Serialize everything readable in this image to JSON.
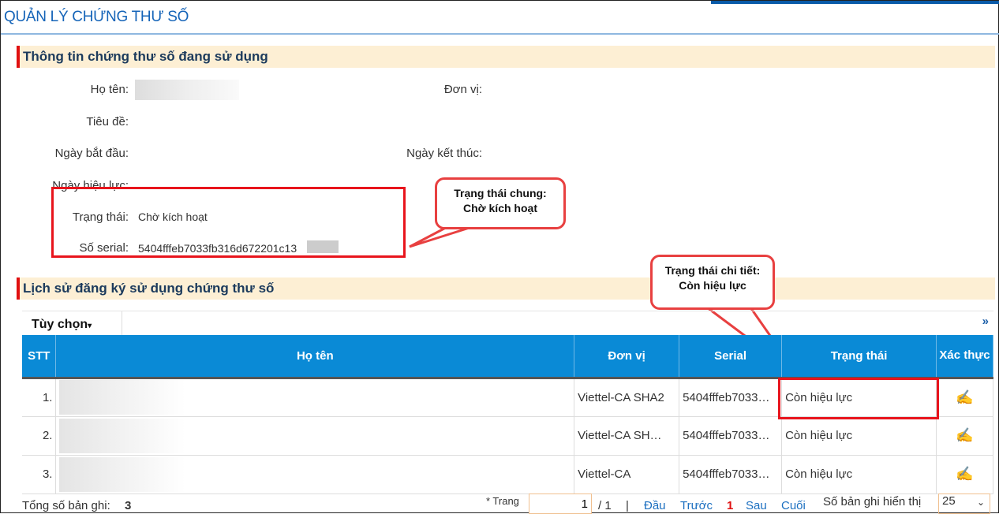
{
  "title": "QUẢN LÝ CHỨNG THƯ SỐ",
  "section1": {
    "title": "Thông tin chứng thư số đang sử dụng",
    "fields": {
      "ho_ten": "Họ tên:",
      "don_vi": "Đơn vị:",
      "tieu_de": "Tiêu đề:",
      "ngay_bat_dau": "Ngày bắt đầu:",
      "ngay_ket_thuc": "Ngày kết thúc:",
      "ngay_hieu_luc": "Ngày hiệu lực:",
      "trang_thai": "Trạng thái:",
      "so_serial": "Số serial:"
    },
    "values": {
      "trang_thai": "Chờ kích hoạt",
      "so_serial": "5404fffeb7033fb316d672201c13"
    }
  },
  "callout1": {
    "line1": "Trạng thái chung:",
    "line2": "Chờ kích hoạt"
  },
  "callout2": {
    "line1": "Trạng thái chi tiết:",
    "line2": "Còn hiệu lực"
  },
  "section2": {
    "title": "Lịch sử đăng ký sử dụng chứng thư số",
    "options": "Tùy chọn",
    "expand": "»"
  },
  "table": {
    "headers": [
      "STT",
      "Họ tên",
      "Đơn vị",
      "Serial",
      "Trạng thái",
      "Xác thực"
    ],
    "rows": [
      {
        "stt": "1.",
        "don_vi": "Viettel-CA SHA2",
        "serial": "5404fffeb7033…",
        "trang_thai": "Còn hiệu lực"
      },
      {
        "stt": "2.",
        "don_vi": "Viettel-CA SH…",
        "serial": "5404fffeb7033…",
        "trang_thai": "Còn hiệu lực"
      },
      {
        "stt": "3.",
        "don_vi": "Viettel-CA",
        "serial": "5404fffeb7033…",
        "trang_thai": "Còn hiệu lực"
      }
    ]
  },
  "footer": {
    "total_label": "Tổng số bản ghi:",
    "total": "3",
    "page_label": "* Trang",
    "page": "1",
    "of": "/ 1",
    "sep": "|",
    "first": "Đầu",
    "prev": "Trước",
    "current": "1",
    "next": "Sau",
    "last": "Cuối",
    "per_page_label": "Số bản ghi hiển thị",
    "per_page": "25"
  },
  "colors": {
    "accent": "#0a8ad6",
    "highlight": "#e8141c"
  }
}
